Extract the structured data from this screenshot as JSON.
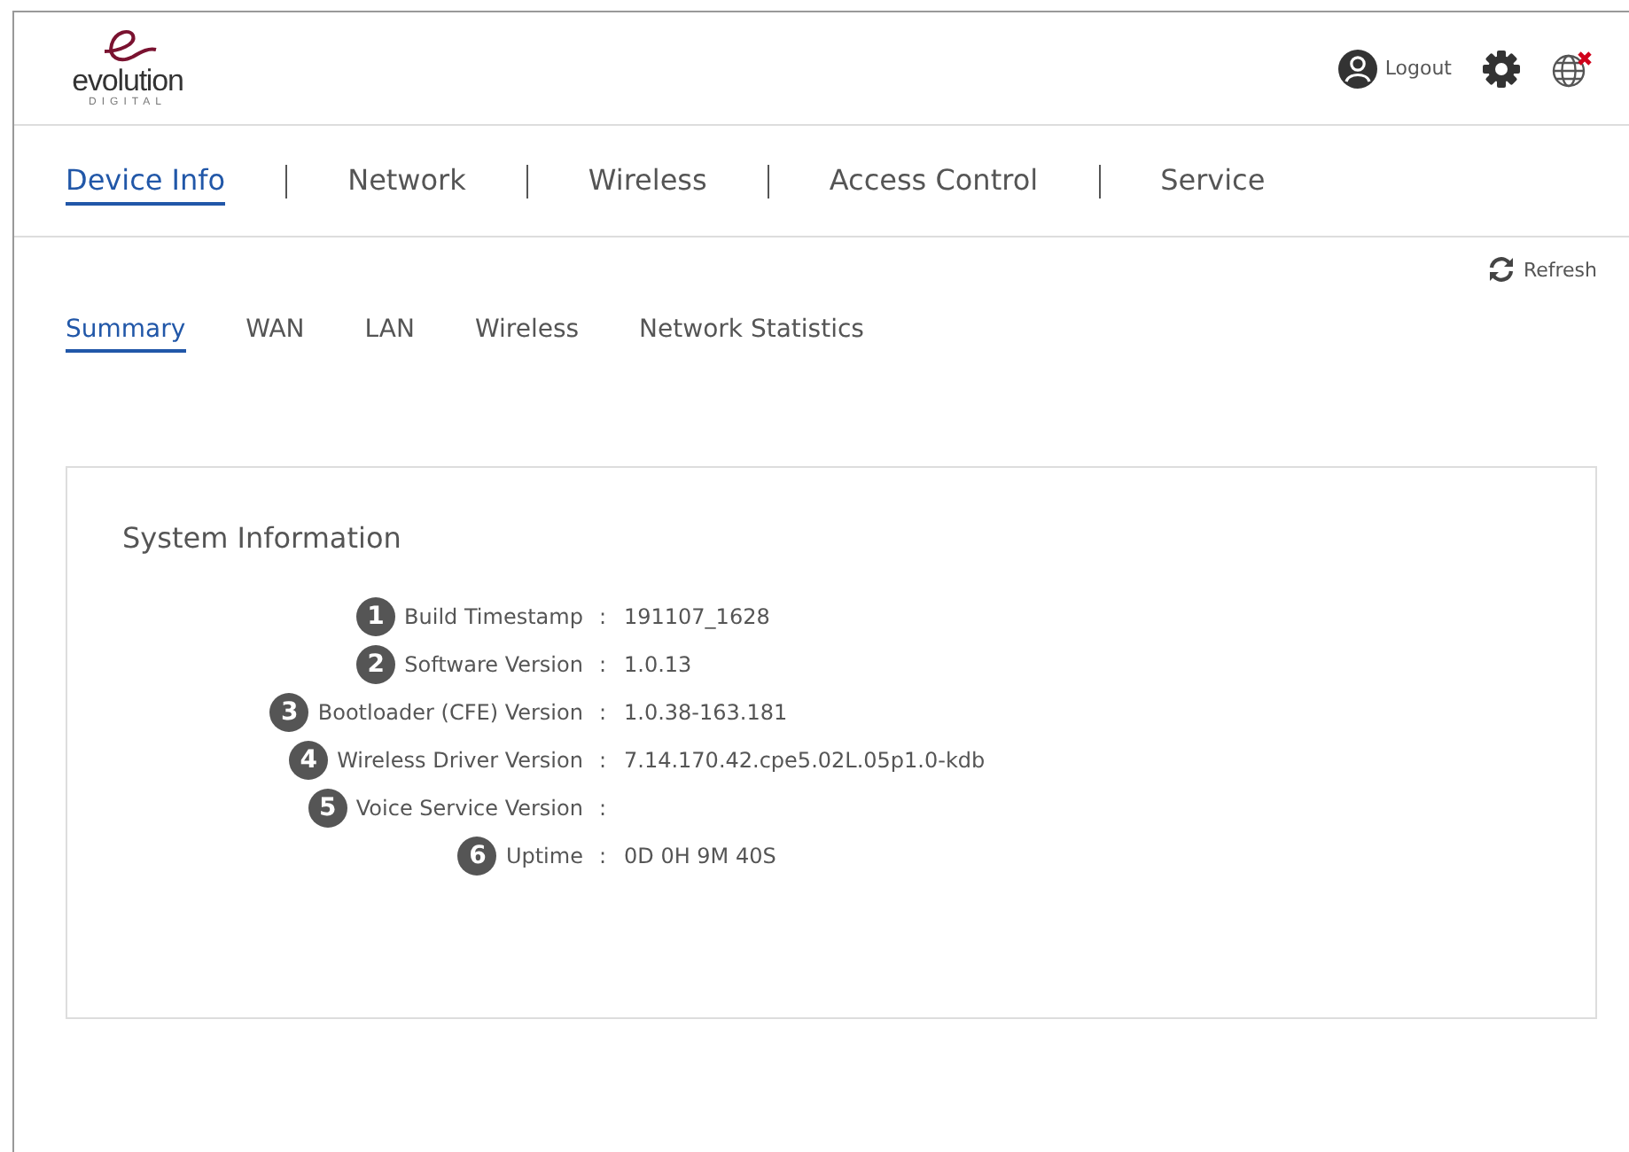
{
  "logo": {
    "name": "evolution",
    "tagline": "DIGITAL"
  },
  "header": {
    "logout": "Logout"
  },
  "nav": [
    {
      "label": "Device Info",
      "selected": true
    },
    {
      "label": "Network",
      "selected": false
    },
    {
      "label": "Wireless",
      "selected": false
    },
    {
      "label": "Access Control",
      "selected": false
    },
    {
      "label": "Service",
      "selected": false
    }
  ],
  "refresh": "Refresh",
  "subtabs": [
    {
      "label": "Summary",
      "selected": true
    },
    {
      "label": "WAN",
      "selected": false
    },
    {
      "label": "LAN",
      "selected": false
    },
    {
      "label": "Wireless",
      "selected": false
    },
    {
      "label": "Network Statistics",
      "selected": false
    }
  ],
  "panel": {
    "title": "System Information",
    "rows": [
      {
        "number": "1",
        "label": "Build Timestamp",
        "separator": ":",
        "value": "191107_1628"
      },
      {
        "number": "2",
        "label": "Software Version",
        "separator": ":",
        "value": "1.0.13"
      },
      {
        "number": "3",
        "label": "Bootloader (CFE) Version",
        "separator": ":",
        "value": "1.0.38-163.181"
      },
      {
        "number": "4",
        "label": "Wireless Driver Version",
        "separator": ":",
        "value": "7.14.170.42.cpe5.02L.05p1.0-kdb"
      },
      {
        "number": "5",
        "label": "Voice Service Version",
        "separator": ":"
      },
      {
        "number": "6",
        "label": "Uptime",
        "separator": ":",
        "value": "0D 0H 9M 40S"
      }
    ]
  }
}
